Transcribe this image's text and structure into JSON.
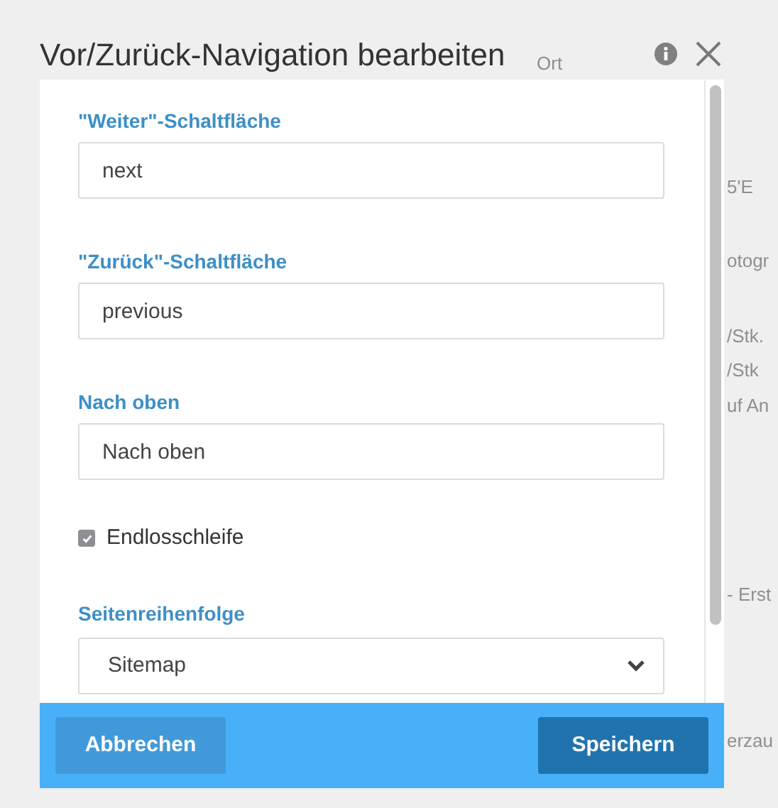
{
  "background_fragments": [
    "Ort",
    "5'E",
    "otogr",
    "/Stk.",
    "/Stk",
    "uf An",
    "- Erst",
    "erzau"
  ],
  "dialog": {
    "title": "Vor/Zurück-Navigation bearbeiten",
    "fields": [
      {
        "kind": "text",
        "label": "\"Weiter\"-Schaltfläche",
        "value": "next"
      },
      {
        "kind": "text",
        "label": "\"Zurück\"-Schaltfläche",
        "value": "previous"
      },
      {
        "kind": "text",
        "label": "Nach oben",
        "value": "Nach oben"
      },
      {
        "kind": "checkbox",
        "label": "Endlosschleife",
        "checked": true
      },
      {
        "kind": "select",
        "label": "Seitenreihenfolge",
        "value": "Sitemap"
      }
    ],
    "buttons": [
      {
        "label": "Abbrechen",
        "kind": "secondary"
      },
      {
        "label": "Speichern",
        "kind": "primary"
      }
    ]
  }
}
